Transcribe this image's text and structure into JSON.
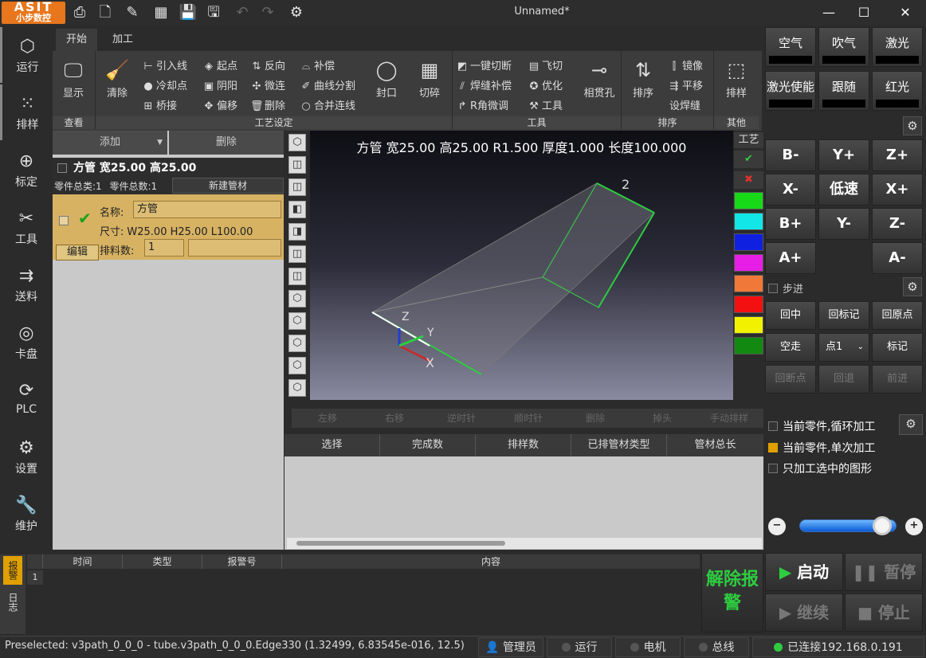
{
  "app": {
    "title": "Unnamed*",
    "logo_top": "ASIT",
    "logo_bottom": "小步数控"
  },
  "titlebar_icons": [
    "print-icon",
    "new-file-icon",
    "edit-file-icon",
    "nesting-icon",
    "save-icon",
    "save-as-icon",
    "undo-icon",
    "redo-icon",
    "gear-icon"
  ],
  "nav": [
    {
      "label": "运行",
      "icon": "cube-icon"
    },
    {
      "label": "排样",
      "icon": "grid-dots-icon"
    },
    {
      "label": "标定",
      "icon": "target-icon"
    },
    {
      "label": "工具",
      "icon": "tools-icon"
    },
    {
      "label": "送料",
      "icon": "feed-icon"
    },
    {
      "label": "卡盘",
      "icon": "chuck-icon"
    },
    {
      "label": "PLC",
      "icon": "plc-icon"
    },
    {
      "label": "设置",
      "icon": "settings-icon"
    },
    {
      "label": "维护",
      "icon": "wrench-icon"
    }
  ],
  "tabs": [
    "开始",
    "加工"
  ],
  "ribbon": {
    "view": {
      "label": "显示",
      "group": "查看"
    },
    "process": {
      "group": "工艺设定",
      "clear": "清除",
      "items": [
        "引入线",
        "起点",
        "反向",
        "补偿",
        "冷却点",
        "阴阳",
        "微连",
        "曲线分割",
        "桥接",
        "偏移",
        "删除",
        "合并连线"
      ],
      "seal": "封口",
      "shred": "切碎"
    },
    "tools": {
      "group": "工具",
      "items": [
        "一键切断",
        "飞切",
        "焊缝补偿",
        "优化",
        "R角微调",
        "工具"
      ],
      "cross": "相贯孔"
    },
    "sort": {
      "group": "排序",
      "sort": "排序",
      "items": [
        "镜像",
        "平移",
        "设焊缝"
      ]
    },
    "other": {
      "group": "其他",
      "nest": "排样"
    }
  },
  "left_panel": {
    "add": "添加",
    "delete": "删除",
    "tube_header": "方管 宽25.00 高25.00",
    "part_types": "零件总类:1",
    "part_total": "零件总数:1",
    "new_tube": "新建管材",
    "part": {
      "name_label": "名称:",
      "name": "方管",
      "size_label": "尺寸:",
      "size": "W25.00 H25.00 L100.00",
      "count_label": "排料数:",
      "count": "1",
      "edit": "编辑"
    }
  },
  "viewport": {
    "info": "方管 宽25.00 高25.00 R1.500 厚度1.000 长度100.000",
    "label_2": "2",
    "axis_x": "X",
    "axis_y": "Y",
    "axis_z": "Z"
  },
  "swatch_panel": {
    "label": "工艺",
    "colors": [
      "#18d918",
      "#12e6e6",
      "#1020e0",
      "#e61ee6",
      "#f07838",
      "#f21010",
      "#f2f200",
      "#128a12"
    ]
  },
  "op_toolbar": [
    "左移",
    "右移",
    "逆时针",
    "顺时针",
    "删除",
    "掉头",
    "手动排样"
  ],
  "table_headers": [
    "选择",
    "完成数",
    "排样数",
    "已排管材类型",
    "管材总长"
  ],
  "right_panel": {
    "top_buttons": [
      "空气",
      "吹气",
      "激光",
      "激光使能",
      "跟随",
      "红光"
    ],
    "jog": [
      "B-",
      "Y+",
      "Z+",
      "X-",
      "低速",
      "X+",
      "B+",
      "Y-",
      "Z-",
      "A+",
      "",
      "A-"
    ],
    "step": "步进",
    "set_buttons": [
      "回中",
      "回标记",
      "回原点",
      "空走",
      "点1",
      "标记",
      "回断点",
      "回退",
      "前进"
    ],
    "options": [
      "当前零件,循环加工",
      "当前零件,单次加工",
      "只加工选中的图形"
    ],
    "slider_value": 0.85
  },
  "alarm": {
    "tabs": [
      "报警",
      "日志"
    ],
    "headers": [
      "时间",
      "类型",
      "报警号",
      "内容"
    ],
    "row_no": "1"
  },
  "controls": {
    "release": "解除报警",
    "start": "启动",
    "pause": "暂停",
    "continue": "继续",
    "stop": "停止"
  },
  "status": {
    "preselected": "Preselected: v3path_0_0_0 - tube.v3path_0_0_0.Edge330 (1.32499, 6.83545e-016, 12.5)",
    "user": "管理员",
    "run": "运行",
    "motor": "电机",
    "bus": "总线",
    "connection": "已连接192.168.0.191"
  }
}
